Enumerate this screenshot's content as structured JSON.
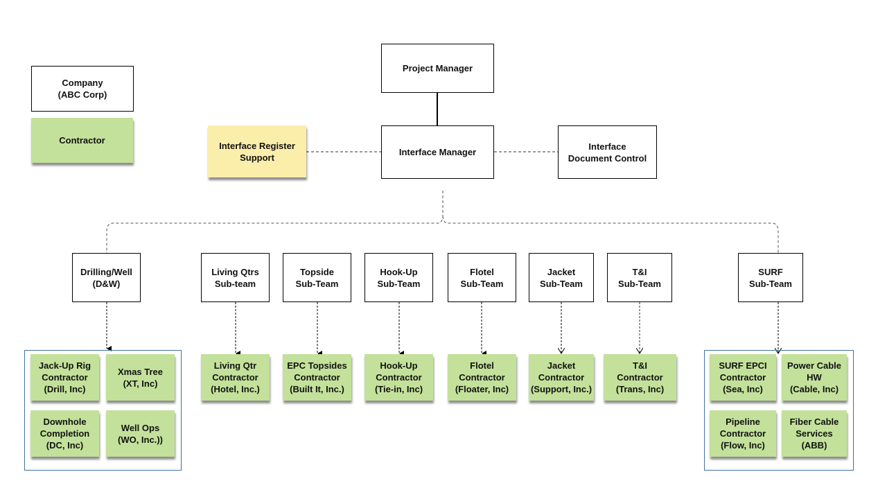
{
  "legend": {
    "company": "Company\n(ABC Corp)",
    "contractor": "Contractor"
  },
  "top": {
    "project_manager": "Project Manager",
    "interface_manager": "Interface Manager",
    "interface_register_support": "Interface Register\nSupport",
    "interface_document_control": "Interface\nDocument Control"
  },
  "subteams": [
    {
      "id": "dw",
      "label": "Drilling/Well\n(D&W)"
    },
    {
      "id": "living",
      "label": "Living Qtrs\nSub-team"
    },
    {
      "id": "topside",
      "label": "Topside\nSub-Team"
    },
    {
      "id": "hookup",
      "label": "Hook-Up\nSub-Team"
    },
    {
      "id": "flotel",
      "label": "Flotel\nSub-Team"
    },
    {
      "id": "jacket",
      "label": "Jacket\nSub-Team"
    },
    {
      "id": "ti",
      "label": "T&I\nSub-Team"
    },
    {
      "id": "surf",
      "label": "SURF\nSub-Team"
    }
  ],
  "contractors": {
    "dw_group": [
      "Jack-Up Rig\nContractor\n(Drill, Inc)",
      "Xmas Tree\n(XT, Inc)",
      "Downhole\nCompletion\n(DC, Inc)",
      "Well Ops\n(WO, Inc.))"
    ],
    "living": "Living Qtr\nContractor\n(Hotel, Inc.)",
    "topside": "EPC Topsides\nContractor\n(Built It, Inc.)",
    "hookup": "Hook-Up\nContractor\n(Tie-in, Inc)",
    "flotel": "Flotel\nContractor\n(Floater, Inc)",
    "jacket": "Jacket\nContractor\n(Support, Inc.)",
    "ti": "T&I\nContractor\n(Trans, Inc)",
    "surf_group": [
      "SURF EPCI\nContractor\n(Sea, Inc)",
      "Power Cable\nHW\n(Cable, Inc)",
      "Pipeline\nContractor\n(Flow, Inc)",
      "Fiber Cable\nServices\n(ABB)"
    ]
  },
  "colors": {
    "contractor_fill": "#c3e19a",
    "support_fill": "#fbeeab",
    "group_border": "#41719c",
    "org_border": "#000000"
  }
}
